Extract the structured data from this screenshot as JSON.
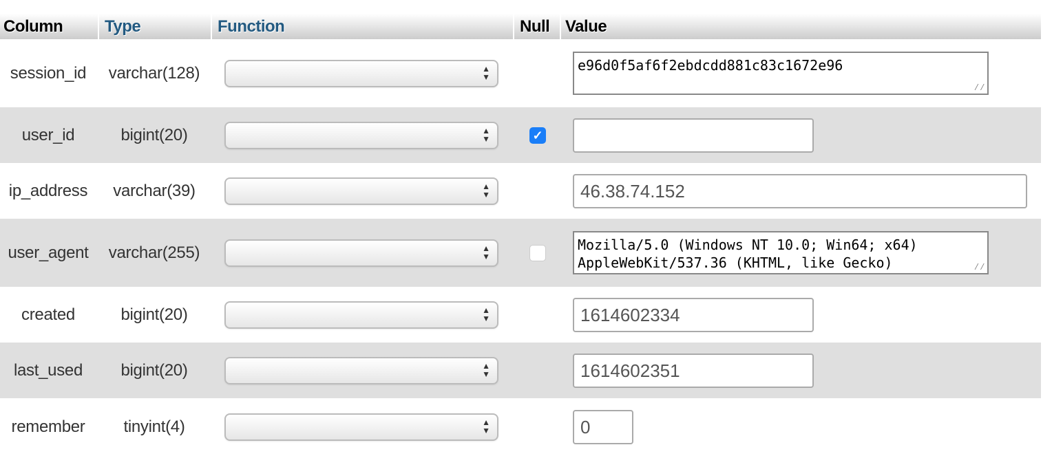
{
  "header": {
    "column": "Column",
    "type": "Type",
    "function": "Function",
    "null": "Null",
    "value": "Value"
  },
  "colors": {
    "link_header": "#235a81",
    "alt_row": "#dfdfdf",
    "checkbox_checked": "#1a7ef8"
  },
  "rows": [
    {
      "column": "session_id",
      "type": "varchar(128)",
      "function": "",
      "null_checkbox": "none",
      "value": "e96d0f5af6f2ebdcdd881c83c1672e96",
      "widget": "textarea"
    },
    {
      "column": "user_id",
      "type": "bigint(20)",
      "function": "",
      "null_checkbox": "checked",
      "value": "",
      "widget": "input"
    },
    {
      "column": "ip_address",
      "type": "varchar(39)",
      "function": "",
      "null_checkbox": "none",
      "value": "46.38.74.152",
      "widget": "input"
    },
    {
      "column": "user_agent",
      "type": "varchar(255)",
      "function": "",
      "null_checkbox": "unchecked",
      "value": "Mozilla/5.0 (Windows NT 10.0; Win64; x64)\nAppleWebKit/537.36 (KHTML, like Gecko)",
      "widget": "textarea"
    },
    {
      "column": "created",
      "type": "bigint(20)",
      "function": "",
      "null_checkbox": "none",
      "value": "1614602334",
      "widget": "input"
    },
    {
      "column": "last_used",
      "type": "bigint(20)",
      "function": "",
      "null_checkbox": "none",
      "value": "1614602351",
      "widget": "input"
    },
    {
      "column": "remember",
      "type": "tinyint(4)",
      "function": "",
      "null_checkbox": "none",
      "value": "0",
      "widget": "input"
    }
  ],
  "icons": {
    "select_arrows": "up-down-arrows-icon",
    "checkmark": "checkmark-icon",
    "resize_grip": "resize-grip-icon"
  }
}
